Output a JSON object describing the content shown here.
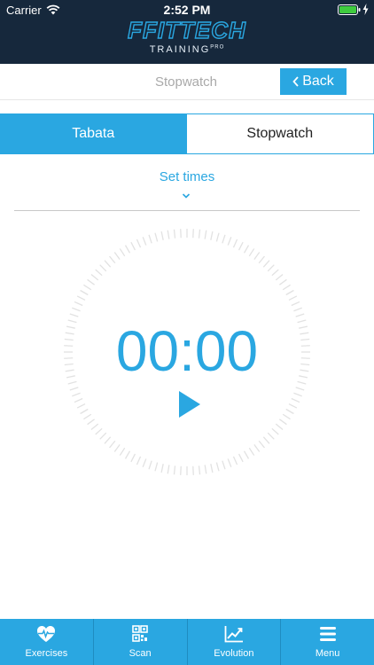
{
  "status": {
    "carrier": "Carrier",
    "time": "2:52 PM"
  },
  "brand": {
    "logo": "FFITTECH",
    "sub": "TRAINING",
    "sub_sup": "PRO"
  },
  "nav": {
    "title": "Stopwatch",
    "back_label": "Back"
  },
  "tabs": [
    {
      "label": "Tabata",
      "active": true
    },
    {
      "label": "Stopwatch",
      "active": false
    }
  ],
  "set_times_label": "Set times",
  "timer": {
    "display": "00:00"
  },
  "tabbar": [
    {
      "label": "Exercises",
      "icon": "heart-pulse-icon"
    },
    {
      "label": "Scan",
      "icon": "qr-code-icon"
    },
    {
      "label": "Evolution",
      "icon": "trend-chart-icon"
    },
    {
      "label": "Menu",
      "icon": "menu-icon"
    }
  ],
  "colors": {
    "accent": "#2aa7e1",
    "header_bg": "#16283c",
    "muted_text": "#a9a9a9",
    "tick": "#e2e2e2"
  }
}
